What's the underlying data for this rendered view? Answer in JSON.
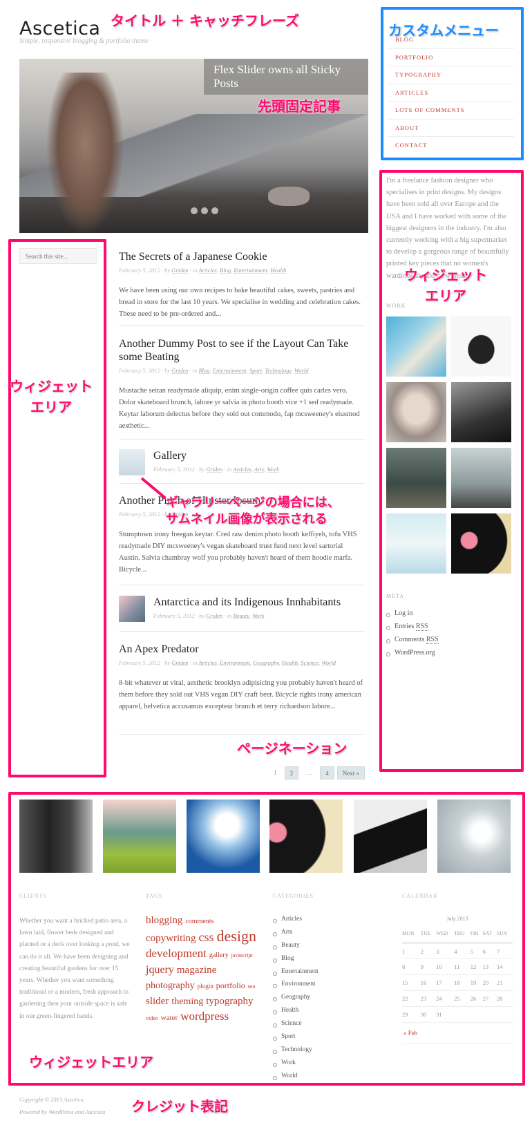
{
  "site": {
    "title": "Ascetica",
    "tagline": "Simple, responsive blogging & portfolio theme"
  },
  "slider": {
    "caption": "Flex Slider owns all Sticky Posts",
    "slides": 3,
    "active_slide": 1
  },
  "menu": [
    "BLOG",
    "PORTFOLIO",
    "TYPOGRAPHY",
    "ARTICLES",
    "LOTS OF COMMENTS",
    "ABOUT",
    "CONTACT"
  ],
  "left_sidebar": {
    "search_placeholder": "Search this site..."
  },
  "right_sidebar": {
    "about": "I'm a freelance fashion designer who specialises in print designs. My designs have been sold all over Europe and the USA and I have worked with some of the biggest designers in the industry. I'm also currently working with a big supermarket to develop a gorgeous range of beautifully printed key pieces that no women's wardrobe should be without.",
    "work_heading": "WORK",
    "meta_heading": "META",
    "meta": {
      "login": "Log in",
      "entries": "Entries",
      "comments": "Comments",
      "rss": "RSS",
      "wordpress": "WordPress.org"
    }
  },
  "posts": [
    {
      "title": "The Secrets of a Japanese Cookie",
      "date": "February 5, 2012",
      "by": "by",
      "author": "Griden",
      "in": "in",
      "cats": [
        "Articles",
        "Blog",
        "Entertainment",
        "Health"
      ],
      "excerpt": "We have been using our own recipes to bake beautiful cakes, sweets, pastries and bread in store for the last 10 years. We specialise in wedding and celebration cakes. These need to be pre-ordered and..."
    },
    {
      "title": "Another Dummy Post to see if the Layout Can Take some Beating",
      "date": "February 5, 2012",
      "by": "by",
      "author": "Griden",
      "in": "in",
      "cats": [
        "Blog",
        "Entertainment",
        "Sport",
        "Technology",
        "World"
      ],
      "excerpt": "Mustache seitan readymade aliquip, enim single-origin coffee quis carles vero. Dolor skateboard brunch, labore yr salvia in photo booth vice +1 sed readymade. Keytar laborum delectus before they sold out commodo, fap mcsweeney's eiusmod aesthetic..."
    },
    {
      "title": "Gallery",
      "date": "February 5, 2012",
      "by": "by",
      "author": "Griden",
      "in": "in",
      "cats": [
        "Articles",
        "Arts",
        "Work"
      ]
    },
    {
      "title": "Another Pinch of Hipster Ipsum",
      "date": "February 5, 2012",
      "by": "by",
      "author": "Griden",
      "in": "in",
      "cats": [],
      "excerpt": "Stumptown irony freegan keytar. Cred raw denim photo booth keffiyeh, tofu VHS readymade DIY mcsweeney's vegan skateboard trust fund next level sartorial Austin. Salvia chambray wolf you probably haven't heard of them hoodie marfa. Bicycle..."
    },
    {
      "title": "Antarctica and its Indigenous Innhabitants",
      "date": "February 5, 2012",
      "by": "by",
      "author": "Griden",
      "in": "in",
      "cats": [
        "Beauty",
        "Work"
      ]
    },
    {
      "title": "An Apex Predator",
      "date": "February 5, 2012",
      "by": "by",
      "author": "Griden",
      "in": "in",
      "cats": [
        "Articles",
        "Environment",
        "Geography",
        "Health",
        "Science",
        "World"
      ],
      "excerpt": "8-bit whatever ut viral, aesthetic brooklyn adipisicing you probably haven't heard of them before they sold out VHS vegan DIY craft beer. Bicycle rights irony american apparel, helvetica accusamus excepteur brunch et terry richardson labore..."
    }
  ],
  "pagination": {
    "current": "1",
    "p2": "2",
    "ellipsis": "…",
    "p4": "4",
    "next": "Next »"
  },
  "footer": {
    "clients_heading": "CLIENTS",
    "clients": "Whether you want a bricked patio area, a lawn laid, flower beds designed and planted or a deck over looking a pond, we can do it all. We have been designing and creating beautiful gardens for over 15 years. Whether you want something traditional or a modern, fresh approach to gardening then your outside space is safe in our green-fingered hands.",
    "tags_heading": "TAGS",
    "tags": [
      [
        "blogging",
        15
      ],
      [
        "comments",
        10
      ],
      [
        "copywriting",
        15
      ],
      [
        "css",
        18
      ],
      [
        "design",
        22
      ],
      [
        "development",
        17
      ],
      [
        "gallery",
        10
      ],
      [
        "javascript",
        8
      ],
      [
        "jquery",
        16
      ],
      [
        "magazine",
        15
      ],
      [
        "photography",
        14
      ],
      [
        "plugin",
        9
      ],
      [
        "portfolio",
        12
      ],
      [
        "seo",
        8
      ],
      [
        "slider",
        15
      ],
      [
        "theming",
        14
      ],
      [
        "typography",
        15
      ],
      [
        "video",
        8
      ],
      [
        "water",
        11
      ],
      [
        "wordpress",
        17
      ]
    ],
    "categories_heading": "CATEGORIES",
    "categories": [
      "Articles",
      "Arts",
      "Beauty",
      "Blog",
      "Entertainment",
      "Environment",
      "Geography",
      "Health",
      "Science",
      "Sport",
      "Technology",
      "Work",
      "World"
    ],
    "calendar_heading": "CALENDAR",
    "calendar": {
      "caption": "July 2013",
      "days": [
        "MON",
        "TUE",
        "WED",
        "THU",
        "FRI",
        "SAT",
        "SUN"
      ],
      "weeks": [
        [
          "1",
          "2",
          "3",
          "4",
          "5",
          "6",
          "7"
        ],
        [
          "8",
          "9",
          "10",
          "11",
          "12",
          "13",
          "14"
        ],
        [
          "15",
          "16",
          "17",
          "18",
          "19",
          "20",
          "21"
        ],
        [
          "22",
          "23",
          "24",
          "25",
          "26",
          "27",
          "28"
        ],
        [
          "29",
          "30",
          "31",
          "",
          "",
          "",
          ""
        ]
      ],
      "prev": "« Feb"
    }
  },
  "credits": {
    "copyright": "Copyright © 2013",
    "site": "Ascetica",
    "powered": "Powered by",
    "wp": "WordPress",
    "and": "and",
    "theme": "Ascetica"
  },
  "annotations": {
    "title": "タイトル ＋ キャッチフレーズ",
    "menu": "カスタムメニュー",
    "sticky": "先頭固定記事",
    "widget_right": "ウィジェット\nエリア",
    "widget_left": "ウィジェット\nエリア",
    "gallery1": "ギャラリーページの場合には、",
    "gallery2": "サムネイル画像が表示される",
    "pagination": "ページネーション",
    "widget_footer": "ウィジェットエリア",
    "credits": "クレジット表記"
  },
  "colors": {
    "accent": "#c0392b",
    "annotation_pink": "#ff0a6c",
    "annotation_blue": "#1a8cff"
  }
}
